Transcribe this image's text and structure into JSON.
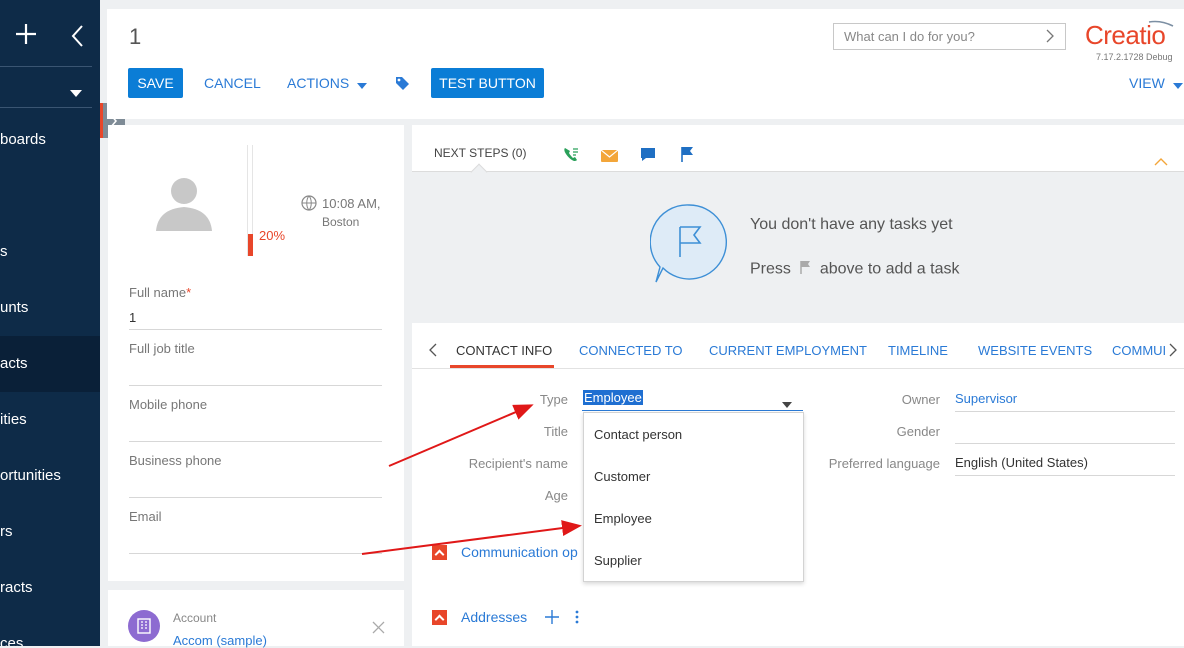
{
  "sidebar": {
    "items": [
      {
        "label": "boards"
      },
      {
        "label": "s"
      },
      {
        "label": "unts"
      },
      {
        "label": "acts"
      },
      {
        "label": "ities"
      },
      {
        "label": "ortunities"
      },
      {
        "label": "rs"
      },
      {
        "label": "racts"
      },
      {
        "label": "ces"
      }
    ]
  },
  "header": {
    "record_title": "1",
    "search_placeholder": "What can I do for you?",
    "brand": "Creatio",
    "version": "7.17.2.1728 Debug",
    "save_label": "SAVE",
    "cancel_label": "CANCEL",
    "actions_label": "ACTIONS",
    "test_button_label": "TEST BUTTON",
    "view_label": "VIEW"
  },
  "profile": {
    "time": "10:08 AM,",
    "city": "Boston",
    "completeness": "20%",
    "completeness_value": 0.2,
    "fields": [
      {
        "label": "Full name",
        "value": "1",
        "required": "*"
      },
      {
        "label": "Full job title",
        "value": ""
      },
      {
        "label": "Mobile phone",
        "value": ""
      },
      {
        "label": "Business phone",
        "value": ""
      },
      {
        "label": "Email",
        "value": ""
      }
    ],
    "account_label": "Account",
    "account_value": "Accom (sample)"
  },
  "next_steps": {
    "title": "NEXT STEPS (0)",
    "empty_line1": "You don't have any tasks yet",
    "empty_line2_a": "Press",
    "empty_line2_b": "above to add a task"
  },
  "tabs": [
    "CONTACT INFO",
    "CONNECTED TO",
    "CURRENT EMPLOYMENT",
    "TIMELINE",
    "WEBSITE EVENTS",
    "COMMUI"
  ],
  "contact_info": {
    "type_label": "Type",
    "type_value": "Employee",
    "title_label": "Title",
    "recipient_label": "Recipient's name",
    "age_label": "Age",
    "owner_label": "Owner",
    "owner_value": "Supervisor",
    "gender_label": "Gender",
    "language_label": "Preferred language",
    "language_value": "English (United States)",
    "dropdown_options": [
      "Contact person",
      "Customer",
      "Employee",
      "Supplier"
    ],
    "communication_label": "Communication op",
    "addresses_label": "Addresses"
  },
  "colors": {
    "sidebar": "#0e2b48",
    "primary": "#0b7dd6",
    "accent": "#e8462a",
    "link": "#2a7ad6"
  }
}
